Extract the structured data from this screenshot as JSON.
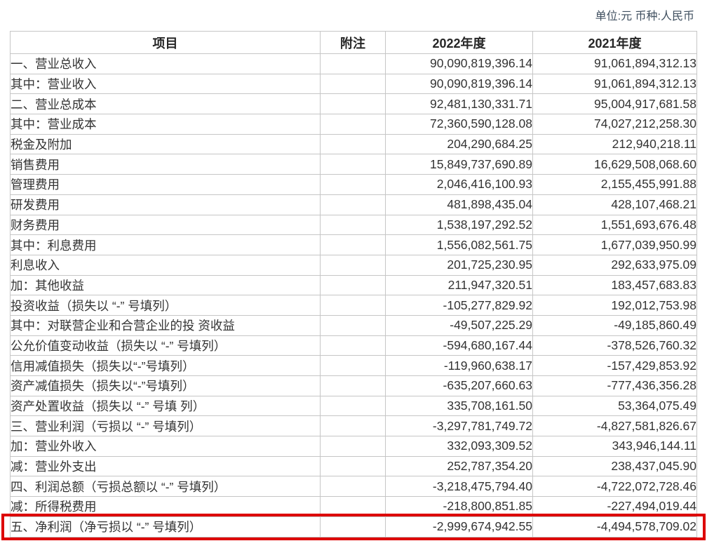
{
  "page": {
    "unit_label": "单位:元 币种:人民币"
  },
  "colors": {
    "highlight_border": "#dd0000",
    "table_border": "#c6c6c6",
    "text": "#333333",
    "header_text": "#262626",
    "unit_text": "#3f4f5f"
  },
  "table": {
    "headers": [
      "项目",
      "附注",
      "2022年度",
      "2021年度"
    ],
    "rows": [
      {
        "item": "一、营业总收入",
        "note": "",
        "y2022": "90,090,819,396.14",
        "y2021": "91,061,894,312.13",
        "highlight": false
      },
      {
        "item": "其中：营业收入",
        "note": "",
        "y2022": "90,090,819,396.14",
        "y2021": "91,061,894,312.13",
        "highlight": false
      },
      {
        "item": "二、营业总成本",
        "note": "",
        "y2022": "92,481,130,331.71",
        "y2021": "95,004,917,681.58",
        "highlight": false
      },
      {
        "item": "其中：营业成本",
        "note": "",
        "y2022": "72,360,590,128.08",
        "y2021": "74,027,212,258.30",
        "highlight": false
      },
      {
        "item": "税金及附加",
        "note": "",
        "y2022": "204,290,684.25",
        "y2021": "212,940,218.11",
        "highlight": false
      },
      {
        "item": "销售费用",
        "note": "",
        "y2022": "15,849,737,690.89",
        "y2021": "16,629,508,068.60",
        "highlight": false
      },
      {
        "item": "管理费用",
        "note": "",
        "y2022": "2,046,416,100.93",
        "y2021": "2,155,455,991.88",
        "highlight": false
      },
      {
        "item": "研发费用",
        "note": "",
        "y2022": "481,898,435.04",
        "y2021": "428,107,468.21",
        "highlight": false
      },
      {
        "item": "财务费用",
        "note": "",
        "y2022": "1,538,197,292.52",
        "y2021": "1,551,693,676.48",
        "highlight": false
      },
      {
        "item": "其中：利息费用",
        "note": "",
        "y2022": "1,556,082,561.75",
        "y2021": "1,677,039,950.99",
        "highlight": false
      },
      {
        "item": "利息收入",
        "note": "",
        "y2022": "201,725,230.95",
        "y2021": "292,633,975.09",
        "highlight": false
      },
      {
        "item": "加：其他收益",
        "note": "",
        "y2022": "211,947,320.51",
        "y2021": "183,457,683.83",
        "highlight": false
      },
      {
        "item": "投资收益（损失以 “-” 号填列）",
        "note": "",
        "y2022": "-105,277,829.92",
        "y2021": "192,012,753.98",
        "highlight": false
      },
      {
        "item": "其中：对联营企业和合营企业的投 资收益",
        "note": "",
        "y2022": "-49,507,225.29",
        "y2021": "-49,185,860.49",
        "highlight": false
      },
      {
        "item": "公允价值变动收益（损失以 “-”  号填列）",
        "note": "",
        "y2022": "-594,680,167.44",
        "y2021": "-378,526,760.32",
        "highlight": false
      },
      {
        "item": "信用减值损失（损失以“-”号填列）",
        "note": "",
        "y2022": "-119,960,638.17",
        "y2021": "-157,429,853.92",
        "highlight": false
      },
      {
        "item": "资产减值损失（损失以“-”号填列）",
        "note": "",
        "y2022": "-635,207,660.63",
        "y2021": "-777,436,356.28",
        "highlight": false
      },
      {
        "item": "资产处置收益（损失以 “-” 号填 列）",
        "note": "",
        "y2022": "335,708,161.50",
        "y2021": "53,364,075.49",
        "highlight": false
      },
      {
        "item": "三、营业利润（亏损以 “-” 号填列）",
        "note": "",
        "y2022": "-3,297,781,749.72",
        "y2021": "-4,827,581,826.67",
        "highlight": false
      },
      {
        "item": "加：营业外收入",
        "note": "",
        "y2022": "332,093,309.52",
        "y2021": "343,946,144.11",
        "highlight": false
      },
      {
        "item": "减：营业外支出",
        "note": "",
        "y2022": "252,787,354.20",
        "y2021": "238,437,045.90",
        "highlight": false
      },
      {
        "item": "四、利润总额（亏损总额以 “-” 号填列）",
        "note": "",
        "y2022": "-3,218,475,794.40",
        "y2021": "-4,722,072,728.46",
        "highlight": false
      },
      {
        "item": "减：所得税费用",
        "note": "",
        "y2022": "-218,800,851.85",
        "y2021": "-227,494,019.44",
        "highlight": false
      },
      {
        "item": "五、净利润（净亏损以 “-” 号填列）",
        "note": "",
        "y2022": "-2,999,674,942.55",
        "y2021": "-4,494,578,709.02",
        "highlight": true
      }
    ]
  }
}
